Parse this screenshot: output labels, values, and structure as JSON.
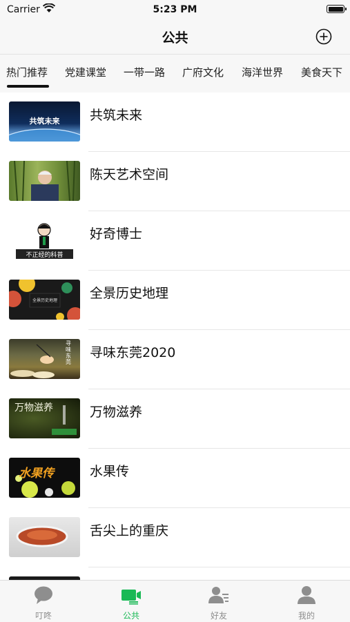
{
  "status_bar": {
    "carrier": "Carrier",
    "time": "5:23 PM"
  },
  "nav": {
    "title": "公共"
  },
  "tabs": [
    {
      "label": "热门推荐",
      "active": true
    },
    {
      "label": "党建课堂"
    },
    {
      "label": "一带一路"
    },
    {
      "label": "广府文化"
    },
    {
      "label": "海洋世界"
    },
    {
      "label": "美食天下"
    }
  ],
  "list": [
    {
      "title": "共筑未来",
      "thumb_text": "共筑未来"
    },
    {
      "title": "陈天艺术空间"
    },
    {
      "title": "好奇博士",
      "thumb_text": "不正经的科普"
    },
    {
      "title": "全景历史地理",
      "thumb_text": "全景历史地理"
    },
    {
      "title": "寻味东莞2020",
      "thumb_text": "寻味东莞"
    },
    {
      "title": "万物滋养",
      "thumb_text": "万物滋养"
    },
    {
      "title": "水果传",
      "thumb_text": "水果传"
    },
    {
      "title": "舌尖上的重庆"
    },
    {
      "title": ""
    }
  ],
  "tabbar": [
    {
      "label": "叮咚",
      "icon": "chat-bubble-icon"
    },
    {
      "label": "公共",
      "icon": "tv-icon",
      "active": true
    },
    {
      "label": "好友",
      "icon": "contacts-icon"
    },
    {
      "label": "我的",
      "icon": "person-icon"
    }
  ],
  "colors": {
    "accent": "#19b955",
    "inactive": "#8e8e8e",
    "bar_bg": "#f7f7f7"
  }
}
